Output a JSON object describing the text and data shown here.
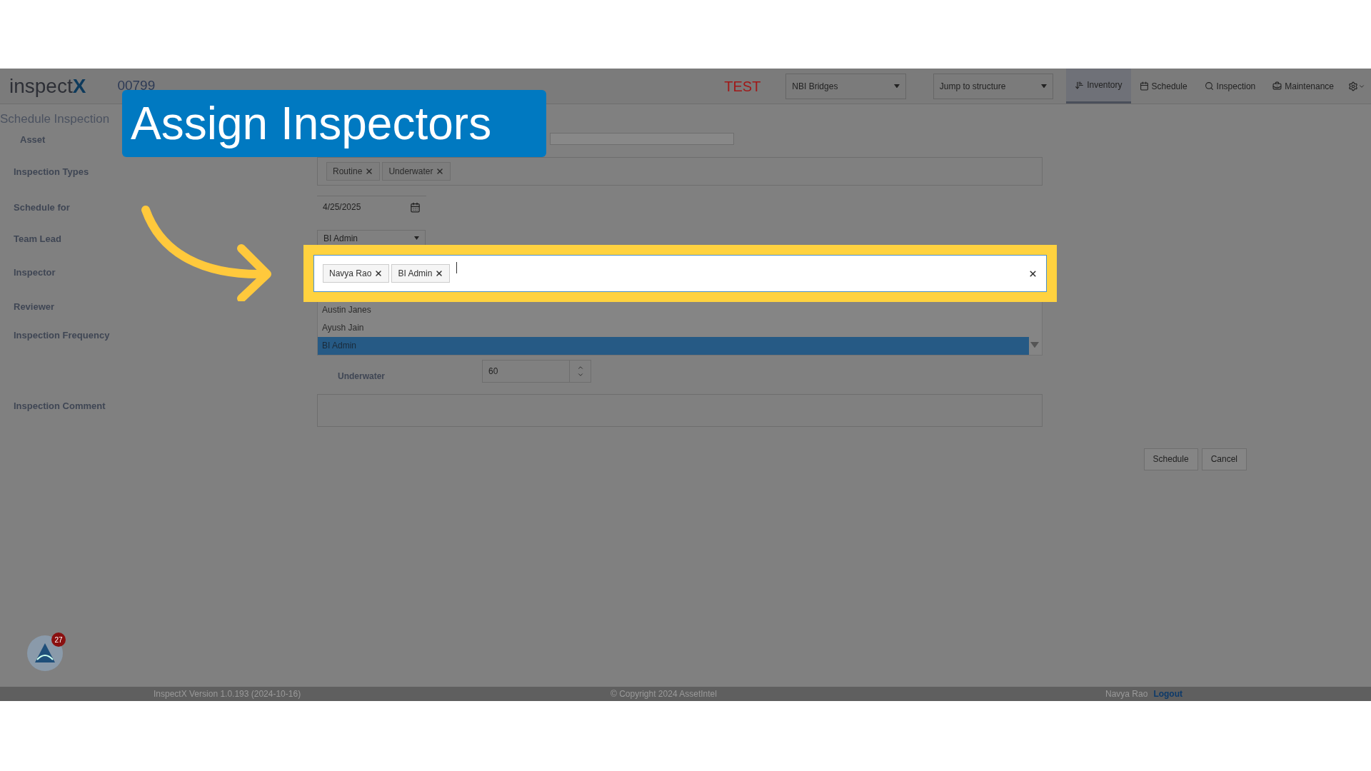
{
  "header": {
    "logo": "inspect",
    "logo_mark": "X",
    "record_id": "00799",
    "environment": "TEST",
    "dataset_select": {
      "value": "NBI Bridges"
    },
    "jump_select": {
      "placeholder": "Jump to structure"
    },
    "nav": [
      {
        "label": "Inventory",
        "selected": true
      },
      {
        "label": "Schedule",
        "selected": false
      },
      {
        "label": "Inspection",
        "selected": false
      },
      {
        "label": "Maintenance",
        "selected": false
      }
    ]
  },
  "callout": {
    "title": "Assign Inspectors"
  },
  "form": {
    "title": "Schedule Inspection",
    "asset": {
      "label": "Asset"
    },
    "inspection_types": {
      "label": "Inspection Types",
      "tags": [
        "Routine",
        "Underwater"
      ]
    },
    "schedule_for": {
      "label": "Schedule for",
      "value": "4/25/2025"
    },
    "team_lead": {
      "label": "Team Lead",
      "value": "BI Admin"
    },
    "inspector": {
      "label": "Inspector",
      "tags": [
        "Navya Rao",
        "BI Admin"
      ]
    },
    "reviewer": {
      "label": "Reviewer"
    },
    "frequency": {
      "label": "Inspection Frequency",
      "sub_label": "Underwater",
      "value": "60"
    },
    "comment": {
      "label": "Inspection Comment"
    }
  },
  "inspector_options": [
    {
      "label": "Austin Janes",
      "selected": false
    },
    {
      "label": "Ayush Jain",
      "selected": false
    },
    {
      "label": "BI Admin",
      "selected": true
    }
  ],
  "buttons": [
    "Schedule",
    "Cancel"
  ],
  "assistant": {
    "badge": "27"
  },
  "footer": {
    "version": "InspectX Version 1.0.193 (2024-10-16)",
    "copyright": "© Copyright 2024 AssetIntel",
    "user": "Navya Rao",
    "logout": "Logout"
  }
}
